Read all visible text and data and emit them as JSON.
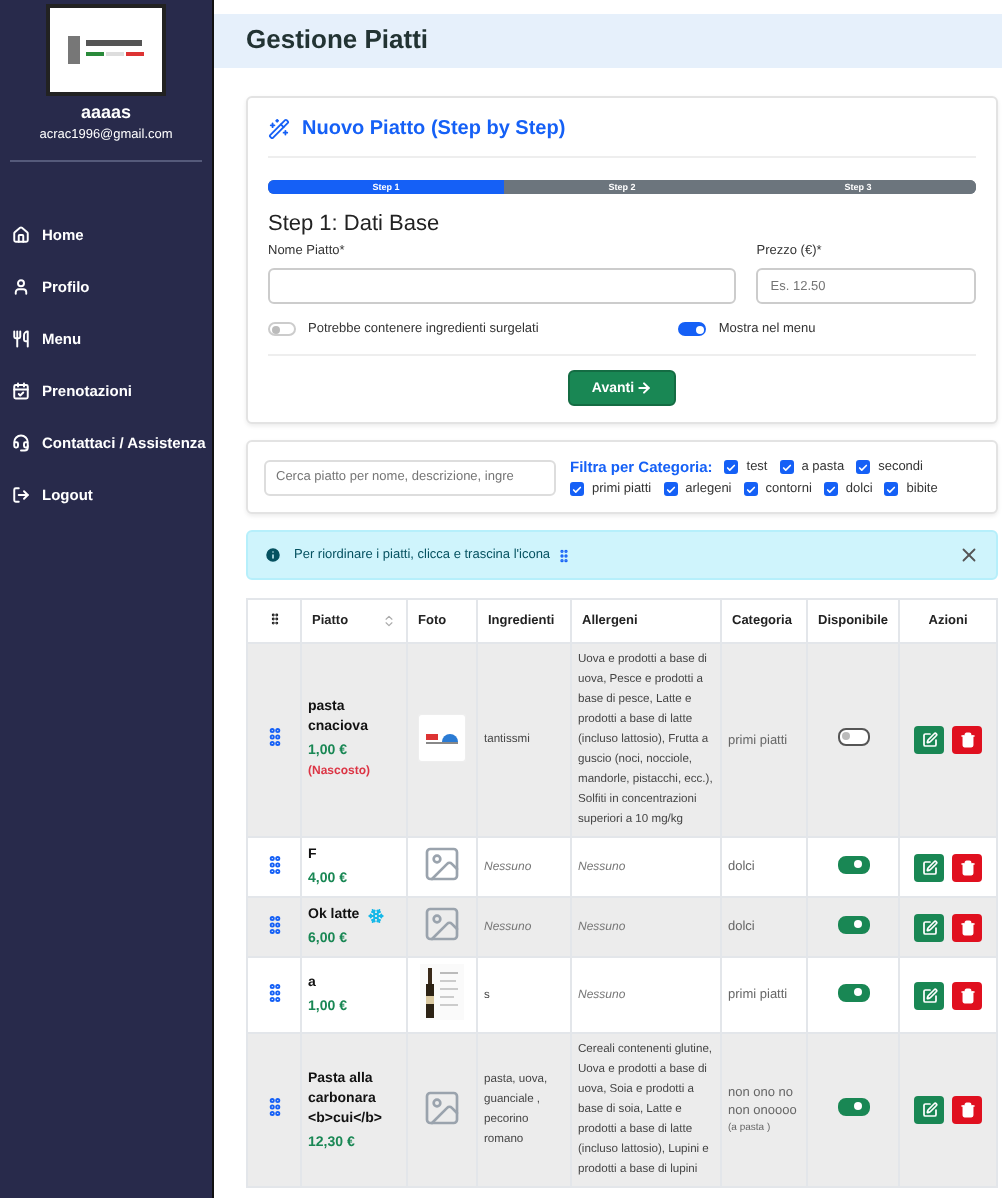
{
  "sidebar": {
    "user_name": "aaaas",
    "email": "acrac1996@gmail.com",
    "items": [
      {
        "label": "Home",
        "kind": "home"
      },
      {
        "label": "Profilo",
        "kind": "user"
      },
      {
        "label": "Menu",
        "kind": "utensils"
      },
      {
        "label": "Prenotazioni",
        "kind": "calendar"
      },
      {
        "label": "Contattaci / Assistenza",
        "kind": "headset"
      },
      {
        "label": "Logout",
        "kind": "logout"
      }
    ]
  },
  "page_title": "Gestione Piatti",
  "wizard": {
    "title": "Nuovo Piatto (Step by Step)",
    "steps": [
      {
        "label": "Step 1",
        "selected": true
      },
      {
        "label": "Step 2",
        "selected": false
      },
      {
        "label": "Step 3",
        "selected": false
      }
    ],
    "step_heading": "Step 1: Dati Base",
    "name_field": {
      "label": "Nome Piatto*"
    },
    "price_field": {
      "label": "Prezzo (€)*",
      "placeholder": "Es. 12.50"
    },
    "toggles": [
      {
        "label": "Potrebbe contenere ingredienti surgelati",
        "on": false
      },
      {
        "label": "Mostra nel menu",
        "on": true
      }
    ],
    "next_button": "Avanti"
  },
  "filter": {
    "search_placeholder": "Cerca piatto per nome, descrizione, ingre",
    "label": "Filtra per Categoria:",
    "categories": [
      {
        "label": "test",
        "checked": true
      },
      {
        "label": "a pasta",
        "checked": true
      },
      {
        "label": "secondi",
        "checked": true
      },
      {
        "label": "primi piatti",
        "checked": true
      },
      {
        "label": "arlegeni",
        "checked": true
      },
      {
        "label": "contorni",
        "checked": true
      },
      {
        "label": "dolci",
        "checked": true
      },
      {
        "label": "bibite",
        "checked": true
      }
    ]
  },
  "alert": {
    "text": "Per riordinare i piatti, clicca e trascina l'icona"
  },
  "table": {
    "columns": [
      "Piatto",
      "Foto",
      "Ingredienti",
      "Allergeni",
      "Categoria",
      "Disponibile",
      "Azioni"
    ],
    "rows": [
      {
        "name": "pasta cnaciova",
        "price": "1,00 €",
        "note": "(Nascosto)",
        "frozen": false,
        "photo": {
          "kind": "logo"
        },
        "ingredients": "tantissmi",
        "ingredients_none": false,
        "allergens": "Uova e prodotti a base di uova, Pesce e prodotti a base di pesce, Latte e prodotti a base di latte (incluso lattosio), Frutta a guscio (noci, nocciole, mandorle, pistacchi, ecc.), Solfiti in concentrazioni superiori a 10 mg/kg",
        "allergens_none": false,
        "category": "primi piatti",
        "available": false
      },
      {
        "name": "F",
        "price": "4,00 €",
        "frozen": false,
        "photo": {
          "kind": "placeholder"
        },
        "ingredients": "Nessuno",
        "ingredients_none": true,
        "allergens": "Nessuno",
        "allergens_none": true,
        "category": "dolci",
        "available": true
      },
      {
        "name": "Ok latte",
        "price": "6,00 €",
        "frozen": true,
        "photo": {
          "kind": "placeholder"
        },
        "ingredients": "Nessuno",
        "ingredients_none": true,
        "allergens": "Nessuno",
        "allergens_none": true,
        "category": "dolci",
        "available": true
      },
      {
        "name": "a",
        "price": "1,00 €",
        "frozen": false,
        "photo": {
          "kind": "bottle"
        },
        "ingredients": "s",
        "ingredients_none": false,
        "allergens": "Nessuno",
        "allergens_none": true,
        "category": "primi piatti",
        "available": true
      },
      {
        "name": "Pasta alla carbonara <b>cui</b>",
        "price": "12,30 €",
        "frozen": false,
        "photo": {
          "kind": "placeholder"
        },
        "ingredients": "pasta, uova, guanciale , pecorino romano",
        "ingredients_none": false,
        "allergens": "Cereali contenenti glutine, Uova e prodotti a base di uova, Soia e prodotti a base di soia, Latte e prodotti a base di latte (incluso lattosio), Lupini e prodotti a base di lupini",
        "allergens_none": false,
        "category": "non ono no non onoooo",
        "category_note": "(a pasta )",
        "available": true
      }
    ]
  }
}
